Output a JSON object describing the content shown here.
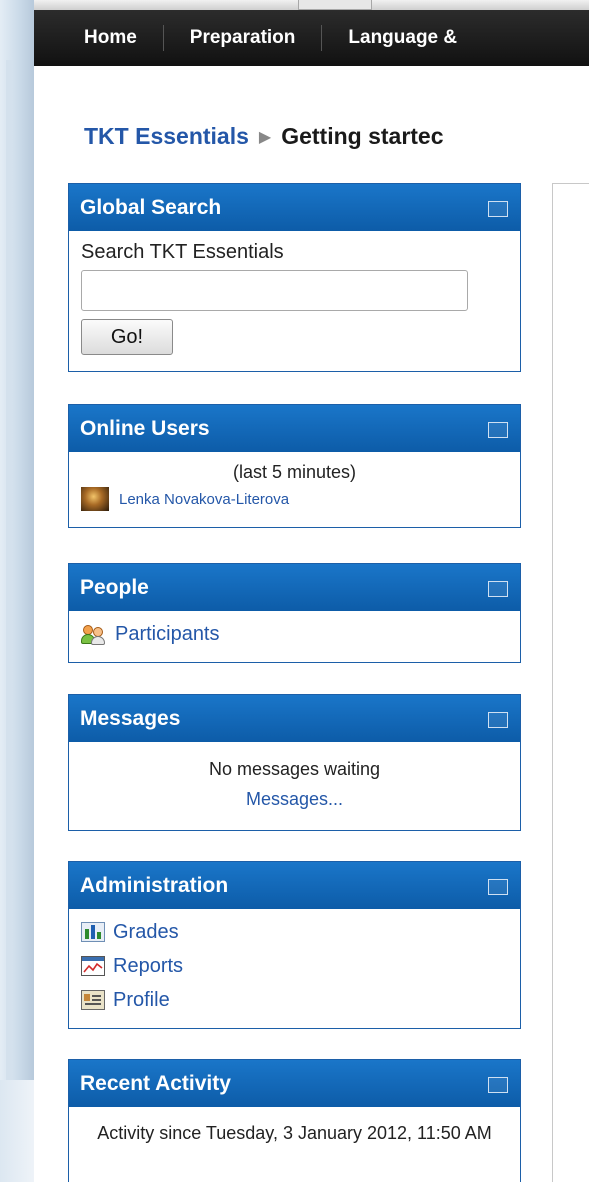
{
  "nav": {
    "items": [
      "Home",
      "Preparation",
      "Language &"
    ]
  },
  "breadcrumb": {
    "course": "TKT Essentials",
    "current": "Getting startec"
  },
  "global_search": {
    "title": "Global Search",
    "label": "Search TKT Essentials",
    "input_value": "",
    "button": "Go!"
  },
  "online_users": {
    "title": "Online Users",
    "subtitle": "(last 5 minutes)",
    "users": [
      "Lenka Novakova-Literova"
    ]
  },
  "people": {
    "title": "People",
    "participants": "Participants"
  },
  "messages": {
    "title": "Messages",
    "status": "No messages waiting",
    "link": "Messages..."
  },
  "administration": {
    "title": "Administration",
    "items": [
      "Grades",
      "Reports",
      "Profile"
    ]
  },
  "recent_activity": {
    "title": "Recent Activity",
    "text": "Activity since Tuesday, 3 January 2012, 11:50 AM"
  }
}
